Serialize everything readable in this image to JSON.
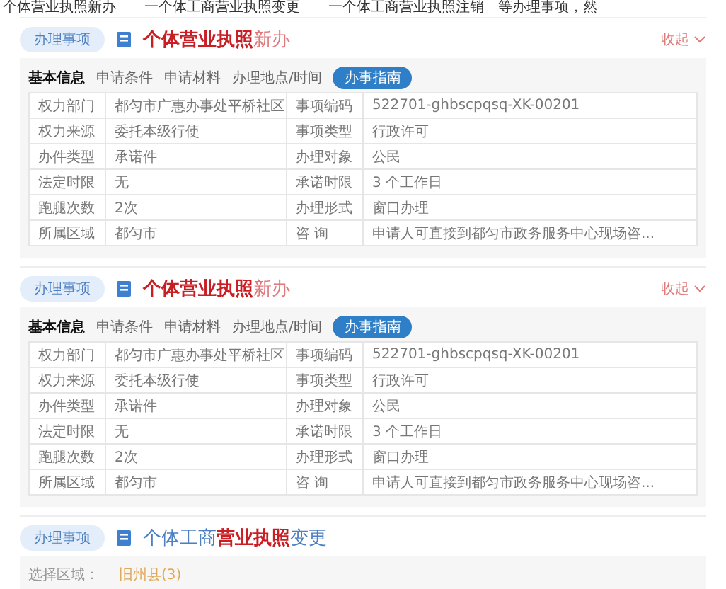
{
  "top_text": "个体营业执照新办　　一个体工商营业执照变更　　一个体工商营业执照注销　等办理事项，然",
  "sections": [
    {
      "badge": "办理事项",
      "title_parts": [
        {
          "text": "个体营业执照",
          "highlight": true
        },
        {
          "text": "新办",
          "highlight": false
        }
      ],
      "toggle": "收起",
      "expanded": true,
      "tabs": [
        {
          "label": "基本信息",
          "kind": "tab",
          "selected": true
        },
        {
          "label": "申请条件",
          "kind": "tab",
          "selected": false
        },
        {
          "label": "申请材料",
          "kind": "tab",
          "selected": false
        },
        {
          "label": "办理地点/时间",
          "kind": "tab",
          "selected": false
        },
        {
          "label": "办事指南",
          "kind": "button"
        }
      ],
      "rows": [
        [
          "权力部门",
          "都匀市广惠办事处平桥社区",
          "事项编码",
          "522701-ghbscpqsq-XK-00201"
        ],
        [
          "权力来源",
          "委托本级行使",
          "事项类型",
          "行政许可"
        ],
        [
          "办件类型",
          "承诺件",
          "办理对象",
          "公民"
        ],
        [
          "法定时限",
          "无",
          "承诺时限",
          "3 个工作日"
        ],
        [
          "跑腿次数",
          "2次",
          "办理形式",
          "窗口办理"
        ],
        [
          "所属区域",
          "都匀市",
          "咨 询",
          "申请人可直接到都匀市政务服务中心现场咨..."
        ]
      ]
    },
    {
      "badge": "办理事项",
      "title_parts": [
        {
          "text": "个体营业执照",
          "highlight": true
        },
        {
          "text": "新办",
          "highlight": false
        }
      ],
      "toggle": "收起",
      "expanded": true,
      "tabs": [
        {
          "label": "基本信息",
          "kind": "tab",
          "selected": true
        },
        {
          "label": "申请条件",
          "kind": "tab",
          "selected": false
        },
        {
          "label": "申请材料",
          "kind": "tab",
          "selected": false
        },
        {
          "label": "办理地点/时间",
          "kind": "tab",
          "selected": false
        },
        {
          "label": "办事指南",
          "kind": "button"
        }
      ],
      "rows": [
        [
          "权力部门",
          "都匀市广惠办事处平桥社区",
          "事项编码",
          "522701-ghbscpqsq-XK-00201"
        ],
        [
          "权力来源",
          "委托本级行使",
          "事项类型",
          "行政许可"
        ],
        [
          "办件类型",
          "承诺件",
          "办理对象",
          "公民"
        ],
        [
          "法定时限",
          "无",
          "承诺时限",
          "3 个工作日"
        ],
        [
          "跑腿次数",
          "2次",
          "办理形式",
          "窗口办理"
        ],
        [
          "所属区域",
          "都匀市",
          "咨 询",
          "申请人可直接到都匀市政务服务中心现场咨..."
        ]
      ]
    },
    {
      "badge": "办理事项",
      "title_parts": [
        {
          "text": "个体工商",
          "highlight": false
        },
        {
          "text": "营业执照",
          "highlight": true
        },
        {
          "text": "变更",
          "highlight": false
        }
      ],
      "expanded": false,
      "filter": {
        "label": "选择区域：",
        "value": "旧州县(3)"
      }
    }
  ]
}
